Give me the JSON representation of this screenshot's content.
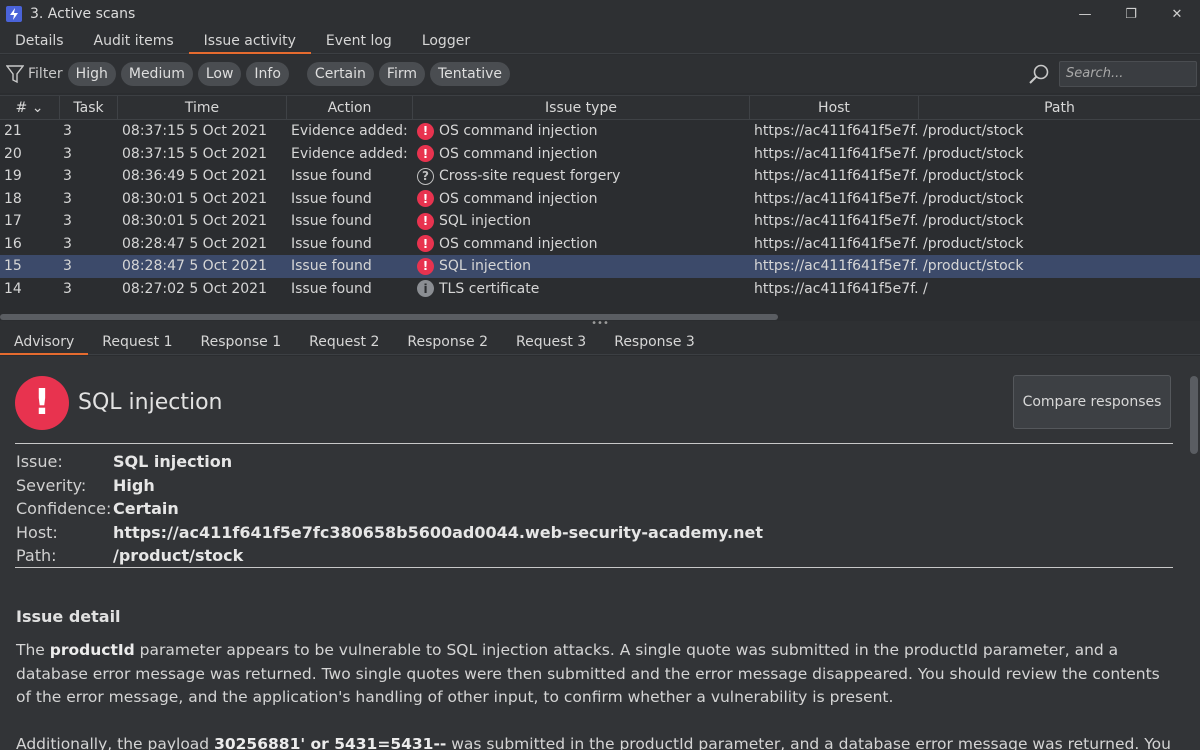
{
  "window": {
    "title": "3. Active scans",
    "minimize": "—",
    "restore": "❐",
    "close": "✕"
  },
  "top_tabs": [
    {
      "label": "Details"
    },
    {
      "label": "Audit items"
    },
    {
      "label": "Issue activity",
      "active": true
    },
    {
      "label": "Event log"
    },
    {
      "label": "Logger"
    }
  ],
  "filter": {
    "label": "Filter",
    "severity_chips": [
      "High",
      "Medium",
      "Low",
      "Info"
    ],
    "confidence_chips": [
      "Certain",
      "Firm",
      "Tentative"
    ],
    "search_placeholder": "Search..."
  },
  "table": {
    "columns": [
      "# ⌄",
      "Task",
      "Time",
      "Action",
      "Issue type",
      "Host",
      "Path"
    ],
    "rows": [
      {
        "num": "21",
        "task": "3",
        "time": "08:37:15 5 Oct 2021",
        "action": "Evidence added: ...",
        "severity": "high",
        "issue": "OS command injection",
        "host": "https://ac411f641f5e7f...",
        "path": "/product/stock"
      },
      {
        "num": "20",
        "task": "3",
        "time": "08:37:15 5 Oct 2021",
        "action": "Evidence added: ...",
        "severity": "high",
        "issue": "OS command injection",
        "host": "https://ac411f641f5e7f...",
        "path": "/product/stock"
      },
      {
        "num": "19",
        "task": "3",
        "time": "08:36:49 5 Oct 2021",
        "action": "Issue found",
        "severity": "unknown",
        "issue": "Cross-site request forgery",
        "host": "https://ac411f641f5e7f...",
        "path": "/product/stock"
      },
      {
        "num": "18",
        "task": "3",
        "time": "08:30:01 5 Oct 2021",
        "action": "Issue found",
        "severity": "high",
        "issue": "OS command injection",
        "host": "https://ac411f641f5e7f...",
        "path": "/product/stock"
      },
      {
        "num": "17",
        "task": "3",
        "time": "08:30:01 5 Oct 2021",
        "action": "Issue found",
        "severity": "high",
        "issue": "SQL injection",
        "host": "https://ac411f641f5e7f...",
        "path": "/product/stock"
      },
      {
        "num": "16",
        "task": "3",
        "time": "08:28:47 5 Oct 2021",
        "action": "Issue found",
        "severity": "high",
        "issue": "OS command injection",
        "host": "https://ac411f641f5e7f...",
        "path": "/product/stock"
      },
      {
        "num": "15",
        "task": "3",
        "time": "08:28:47 5 Oct 2021",
        "action": "Issue found",
        "severity": "high",
        "issue": "SQL injection",
        "host": "https://ac411f641f5e7f...",
        "path": "/product/stock",
        "selected": true
      },
      {
        "num": "14",
        "task": "3",
        "time": "08:27:02 5 Oct 2021",
        "action": "Issue found",
        "severity": "info",
        "issue": "TLS certificate",
        "host": "https://ac411f641f5e7f...",
        "path": "/"
      }
    ]
  },
  "splitter": {
    "glyph": "•••"
  },
  "bottom_tabs": [
    {
      "label": "Advisory",
      "active": true
    },
    {
      "label": "Request 1"
    },
    {
      "label": "Response 1"
    },
    {
      "label": "Request 2"
    },
    {
      "label": "Response 2"
    },
    {
      "label": "Request 3"
    },
    {
      "label": "Response 3"
    }
  ],
  "advisory": {
    "icon": "!",
    "title": "SQL injection",
    "compare_button": "Compare responses",
    "details": [
      {
        "label": "Issue:",
        "value": "SQL injection"
      },
      {
        "label": "Severity:",
        "value": "High"
      },
      {
        "label": "Confidence:",
        "value": "Certain"
      },
      {
        "label": "Host:",
        "value": "https://ac411f641f5e7fc380658b5600ad0044.web-security-academy.net"
      },
      {
        "label": "Path:",
        "value": "/product/stock"
      }
    ],
    "section_title": "Issue detail",
    "para1": {
      "pre": "The ",
      "bold": "productId",
      "post": " parameter appears to be vulnerable to SQL injection attacks. A single quote was submitted in the productId parameter, and a database error message was returned. Two single quotes were then submitted and the error message disappeared. You should review the contents of the error message, and the application's handling of other input, to confirm whether a vulnerability is present."
    },
    "para2": {
      "pre": "Additionally, the payload ",
      "bold": "30256881' or 5431=5431--",
      "post": " was submitted in the productId parameter, and a database error message was returned. You should"
    }
  },
  "colors": {
    "accent_tab": "#e66b2f",
    "severity_high": "#e8334f",
    "selected_row": "#3c4a6a"
  }
}
